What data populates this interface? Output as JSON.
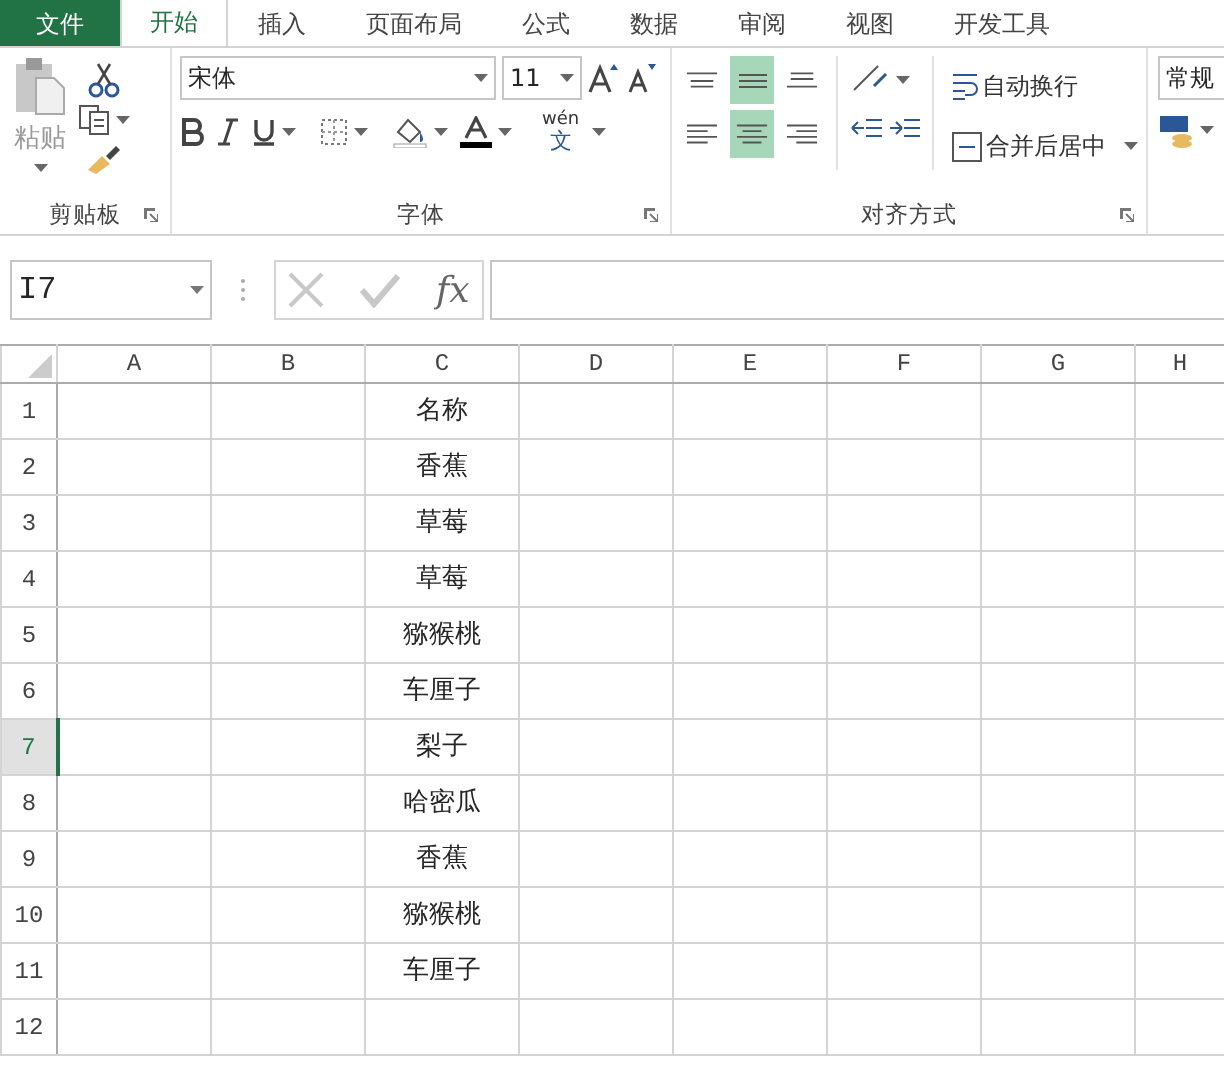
{
  "tabs": [
    {
      "label": "文件",
      "kind": "file",
      "selected": false
    },
    {
      "label": "开始",
      "kind": "tab",
      "selected": true
    },
    {
      "label": "插入",
      "kind": "tab",
      "selected": false
    },
    {
      "label": "页面布局",
      "kind": "tab",
      "selected": false
    },
    {
      "label": "公式",
      "kind": "tab",
      "selected": false
    },
    {
      "label": "数据",
      "kind": "tab",
      "selected": false
    },
    {
      "label": "审阅",
      "kind": "tab",
      "selected": false
    },
    {
      "label": "视图",
      "kind": "tab",
      "selected": false
    },
    {
      "label": "开发工具",
      "kind": "tab",
      "selected": false
    }
  ],
  "clipboard": {
    "paste_label": "粘贴",
    "group_label": "剪贴板"
  },
  "font": {
    "name": "宋体",
    "size": "11",
    "phonetic_top": "wén",
    "phonetic_bottom": "文",
    "group_label": "字体"
  },
  "alignment": {
    "vertical": [
      {
        "kind": "top",
        "selected": false
      },
      {
        "kind": "middle",
        "selected": true
      },
      {
        "kind": "bottom",
        "selected": false
      }
    ],
    "horizontal": [
      {
        "kind": "left",
        "selected": false
      },
      {
        "kind": "center",
        "selected": true
      },
      {
        "kind": "right",
        "selected": false
      }
    ],
    "wrap_label": "自动换行",
    "merge_label": "合并后居中",
    "group_label": "对齐方式"
  },
  "number": {
    "format": "常规"
  },
  "formula_bar": {
    "name_box": "I7",
    "fx": "fx"
  },
  "sheet": {
    "columns": [
      "A",
      "B",
      "C",
      "D",
      "E",
      "F",
      "G",
      "H"
    ],
    "rows": [
      {
        "number": "1",
        "selected": false,
        "c": "名称"
      },
      {
        "number": "2",
        "selected": false,
        "c": "香蕉"
      },
      {
        "number": "3",
        "selected": false,
        "c": "草莓"
      },
      {
        "number": "4",
        "selected": false,
        "c": "草莓"
      },
      {
        "number": "5",
        "selected": false,
        "c": "猕猴桃"
      },
      {
        "number": "6",
        "selected": false,
        "c": "车厘子"
      },
      {
        "number": "7",
        "selected": true,
        "c": "梨子"
      },
      {
        "number": "8",
        "selected": false,
        "c": "哈密瓜"
      },
      {
        "number": "9",
        "selected": false,
        "c": "香蕉"
      },
      {
        "number": "10",
        "selected": false,
        "c": "猕猴桃"
      },
      {
        "number": "11",
        "selected": false,
        "c": "车厘子"
      },
      {
        "number": "12",
        "selected": false,
        "c": ""
      }
    ]
  }
}
